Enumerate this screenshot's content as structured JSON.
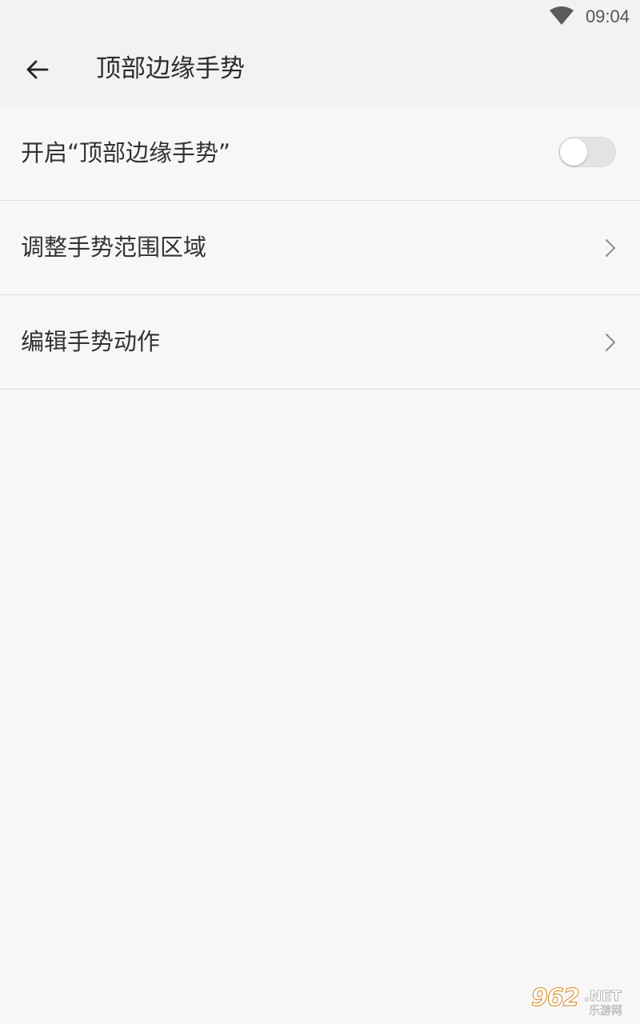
{
  "status_bar": {
    "time": "09:04",
    "wifi_icon": "wifi-icon"
  },
  "app_bar": {
    "back_icon": "arrow-back-icon",
    "title": "顶部边缘手势"
  },
  "settings": {
    "items": [
      {
        "label": "开启“顶部边缘手势”",
        "control": "toggle",
        "enabled": false
      },
      {
        "label": "调整手势范围区域",
        "control": "chevron",
        "icon": "chevron-right-icon"
      },
      {
        "label": "编辑手势动作",
        "control": "chevron",
        "icon": "chevron-right-icon"
      }
    ]
  },
  "watermark": {
    "main": "962",
    "net": ".NET",
    "sub": "乐游网"
  },
  "colors": {
    "background": "#f7f7f7",
    "app_bar": "#f2f2f2",
    "divider": "#dcdcdc",
    "text": "#333333",
    "toggle_off_track": "#e3e3e3",
    "toggle_knob": "#ffffff",
    "watermark_accent": "#d98a1a"
  }
}
